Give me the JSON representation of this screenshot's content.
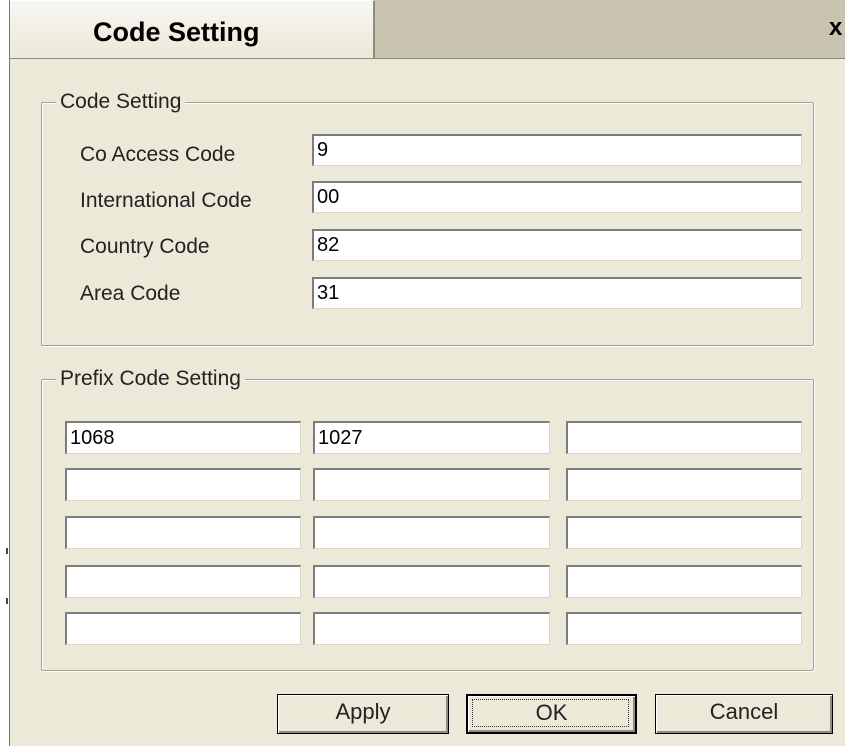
{
  "window": {
    "tab_title": "Code Setting",
    "close_glyph": "x"
  },
  "code_setting": {
    "legend": "Code Setting",
    "rows": [
      {
        "label": "Co Access Code",
        "value": "9"
      },
      {
        "label": "International Code",
        "value": "00"
      },
      {
        "label": "Country Code",
        "value": "82"
      },
      {
        "label": "Area Code",
        "value": "31"
      }
    ]
  },
  "prefix_code_setting": {
    "legend": "Prefix Code Setting",
    "cells": [
      [
        "1068",
        "1027",
        ""
      ],
      [
        "",
        "",
        ""
      ],
      [
        "",
        "",
        ""
      ],
      [
        "",
        "",
        ""
      ],
      [
        "",
        "",
        ""
      ]
    ]
  },
  "buttons": {
    "apply": "Apply",
    "ok": "OK",
    "cancel": "Cancel"
  }
}
